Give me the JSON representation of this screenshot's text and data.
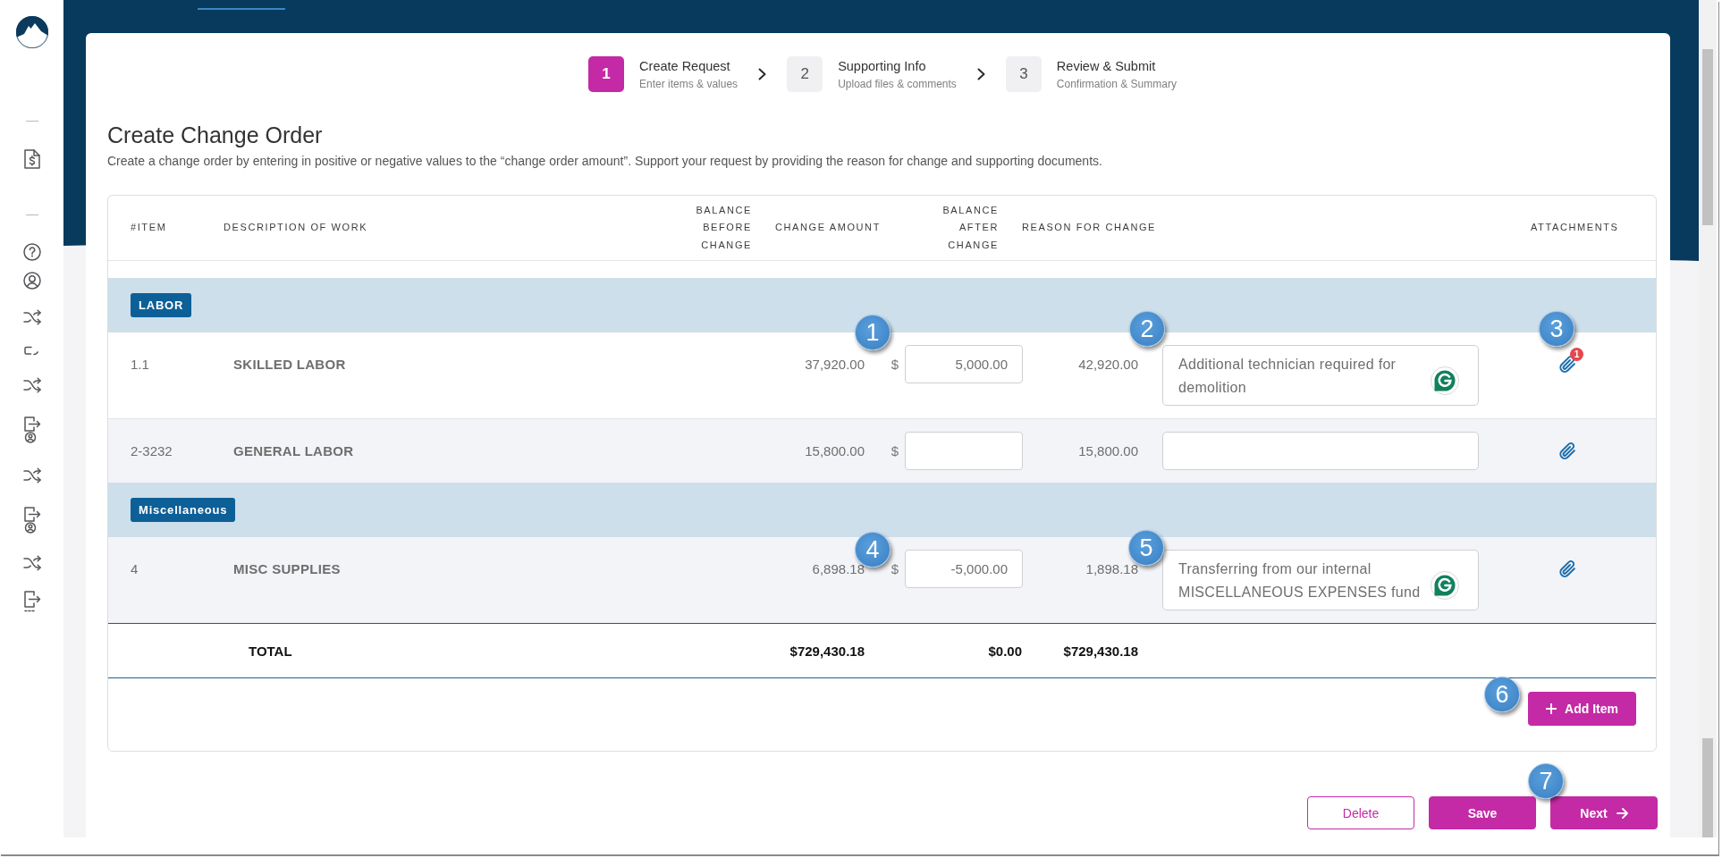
{
  "steps": [
    {
      "number": "1",
      "title": "Create Request",
      "subtitle": "Enter items & values",
      "selected": true
    },
    {
      "number": "2",
      "title": "Supporting Info",
      "subtitle": "Upload files & comments",
      "selected": false
    },
    {
      "number": "3",
      "title": "Review & Submit",
      "subtitle": "Confirmation & Summary",
      "selected": false
    }
  ],
  "page": {
    "title": "Create Change Order",
    "description": "Create a change order by entering in positive or negative values to the “change order amount”. Support your request by providing the reason for change and supporting documents."
  },
  "table": {
    "columns": [
      "#ITEM",
      "DESCRIPTION OF WORK",
      "BALANCE BEFORE CHANGE",
      "CHANGE AMOUNT",
      "BALANCE AFTER CHANGE",
      "REASON FOR CHANGE",
      "ATTACHMENTS"
    ],
    "groups": [
      {
        "label": "LABOR",
        "rows": [
          {
            "item": "1.1",
            "description": "SKILLED LABOR",
            "balance_before": "37,920.00",
            "currency": "$",
            "change_amount": "5,000.00",
            "balance_after": "42,920.00",
            "reason": "Additional technician required for demolition",
            "grammar_badge": true,
            "attachment_count": "1",
            "shaded": false
          },
          {
            "item": "2-3232",
            "description": "GENERAL LABOR",
            "balance_before": "15,800.00",
            "currency": "$",
            "balance_after": "15,800.00",
            "grammar_badge": false,
            "shaded": true
          }
        ]
      },
      {
        "label": "Miscellaneous",
        "rows": [
          {
            "item": "4",
            "description": "MISC SUPPLIES",
            "balance_before": "6,898.18",
            "currency": "$",
            "change_amount": "-5,000.00",
            "balance_after": "1,898.18",
            "reason": "Transferring from our internal MISCELLANEOUS EXPENSES fund",
            "grammar_badge": true,
            "shaded": true
          }
        ]
      }
    ],
    "total": {
      "label": "TOTAL",
      "balance_before": "$729,430.18",
      "change_amount": "$0.00",
      "balance_after": "$729,430.18"
    },
    "add_button": {
      "label": "Add Item"
    }
  },
  "actions": [
    {
      "label": "Delete",
      "kind": "outline",
      "arrow": false
    },
    {
      "label": "Save",
      "kind": "filled",
      "arrow": false
    },
    {
      "label": "Next",
      "kind": "filled",
      "arrow": true
    }
  ],
  "callouts": [
    {
      "label": "1"
    },
    {
      "label": "2"
    },
    {
      "label": "3"
    },
    {
      "label": "4"
    },
    {
      "label": "5"
    },
    {
      "label": "6"
    },
    {
      "label": "7"
    }
  ]
}
